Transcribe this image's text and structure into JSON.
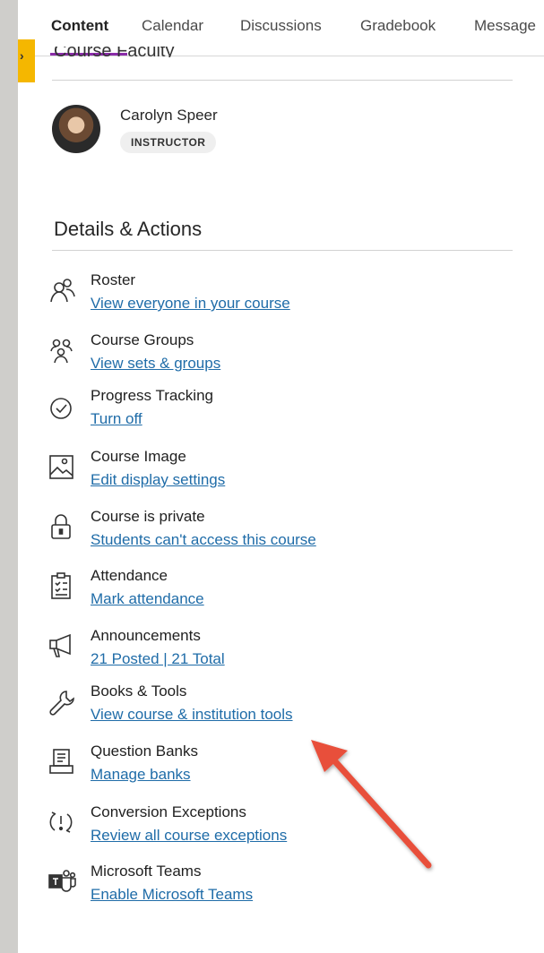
{
  "nav": {
    "tabs": [
      {
        "label": "Content"
      },
      {
        "label": "Calendar"
      },
      {
        "label": "Discussions"
      },
      {
        "label": "Gradebook"
      },
      {
        "label": "Message"
      }
    ]
  },
  "faculty": {
    "heading_partial": "Course Faculty",
    "name": "Carolyn Speer",
    "role": "INSTRUCTOR"
  },
  "details": {
    "title": "Details & Actions",
    "items": [
      {
        "title": "Roster",
        "link": "View everyone in your course",
        "icon": "roster-icon"
      },
      {
        "title": "Course Groups",
        "link": "View sets & groups",
        "icon": "groups-icon"
      },
      {
        "title": "Progress Tracking",
        "link": "Turn off",
        "icon": "check-circle-icon"
      },
      {
        "title": "Course Image",
        "link": "Edit display settings",
        "icon": "image-icon"
      },
      {
        "title": "Course is private",
        "link": "Students can't access this course",
        "icon": "lock-icon"
      },
      {
        "title": "Attendance",
        "link": "Mark attendance",
        "icon": "clipboard-icon"
      },
      {
        "title": "Announcements",
        "link": "21 Posted | 21 Total",
        "icon": "megaphone-icon"
      },
      {
        "title": "Books & Tools",
        "link": "View course & institution tools",
        "icon": "wrench-icon"
      },
      {
        "title": "Question Banks",
        "link": "Manage banks",
        "icon": "question-bank-icon"
      },
      {
        "title": "Conversion Exceptions",
        "link": "Review all course exceptions",
        "icon": "exception-icon"
      },
      {
        "title": "Microsoft Teams",
        "link": "Enable Microsoft Teams",
        "icon": "teams-icon"
      }
    ]
  },
  "colors": {
    "accent": "#8a2ca8",
    "link": "#1f6ca8",
    "annotation_arrow": "#e8503a",
    "side_tab": "#f5b700"
  }
}
